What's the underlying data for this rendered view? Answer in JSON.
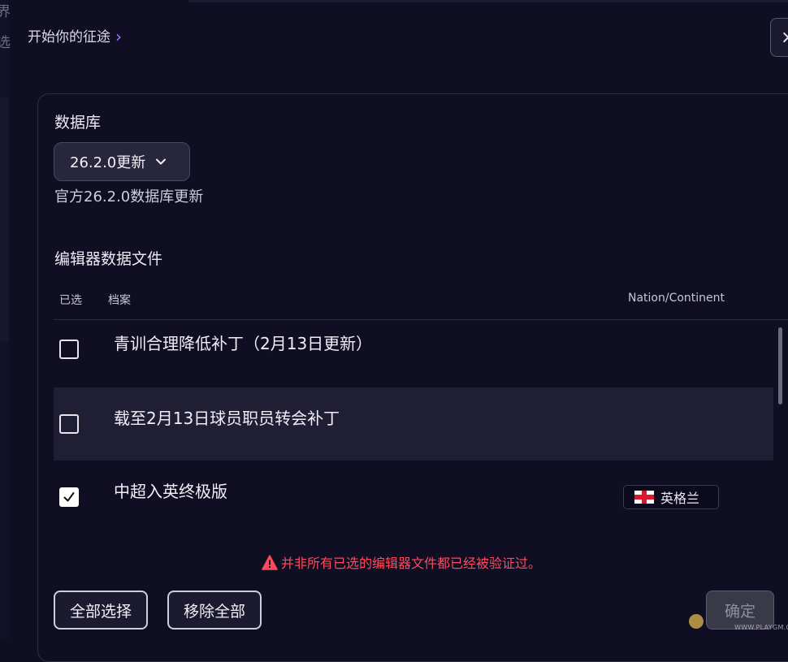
{
  "left_strip": {
    "char_1": "界",
    "char_2": "选"
  },
  "breadcrumb": {
    "label": "开始你的征途",
    "chevron": "›"
  },
  "close_button": {
    "label": "×"
  },
  "database": {
    "title": "数据库",
    "selected": "26.2.0更新",
    "description": "官方26.2.0数据库更新"
  },
  "editor_files": {
    "title": "编辑器数据文件",
    "columns": {
      "selected": "已选",
      "file": "档案",
      "nation": "Nation/Continent"
    },
    "rows": [
      {
        "label": "青训合理降低补丁（2月13日更新）",
        "checked": false,
        "nation": ""
      },
      {
        "label": "载至2月13日球员职员转会补丁",
        "checked": false,
        "nation": ""
      },
      {
        "label": "中超入英终极版",
        "checked": true,
        "nation": "英格兰",
        "flag_icon": "england-flag-icon"
      }
    ]
  },
  "warning": {
    "text": "并非所有已选的编辑器文件都已经被验证过。",
    "color": "#ff4a5d"
  },
  "buttons": {
    "select_all": "全部选择",
    "remove_all": "移除全部",
    "confirm": "确定"
  },
  "watermark": {
    "text": "WWW.PLAYGM.CC"
  }
}
